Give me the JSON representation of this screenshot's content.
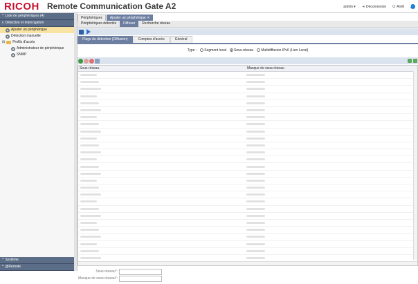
{
  "header": {
    "logo": "RICOH",
    "title": "Remote Communication Gate A2",
    "user": "admin ▾",
    "logout": "Déconnexion",
    "stop": "Arrêt",
    "info": "i"
  },
  "sidebar": {
    "section_list": "Liste de périphériques (4)",
    "section_detection": "Détection et interrogation",
    "items": [
      {
        "label": "Ajouter un périphérique",
        "selected": true
      },
      {
        "label": "Détection manuelle",
        "selected": false
      },
      {
        "label": "Profils d'accès",
        "selected": false
      },
      {
        "label": "Administrateur de périphérique",
        "selected": false
      },
      {
        "label": "SNMP",
        "selected": false
      }
    ],
    "bottom": [
      "Système",
      "@Remote"
    ]
  },
  "tabs": [
    "Périphériques",
    "Ajouter un périphérique ✕"
  ],
  "subtabs": [
    "Périphériques détectés",
    "Diffuser",
    "Recherche réseau"
  ],
  "detail_tabs": [
    "Plage de détection (Diffusion)",
    "Comptes d'accès",
    "Général"
  ],
  "type_row": {
    "label": "Type :",
    "options": [
      {
        "label": "Segment local",
        "checked": false
      },
      {
        "label": "Sous-réseau",
        "checked": true
      },
      {
        "label": "Multidiffusion IPv6 (Lien Local)",
        "checked": false
      }
    ]
  },
  "grid": {
    "col1": "Sous-réseau",
    "col2": "Masque de sous-réseau",
    "row_count": 29
  },
  "form": {
    "subnet_label": "Sous-réseau*:",
    "mask_label": "Masque de sous-réseau*:"
  },
  "colors": {
    "brand": "#c8102e",
    "header_blue": "#5b6d87",
    "tab_active": "#6d7fa0",
    "selected": "#f9e3a3"
  }
}
